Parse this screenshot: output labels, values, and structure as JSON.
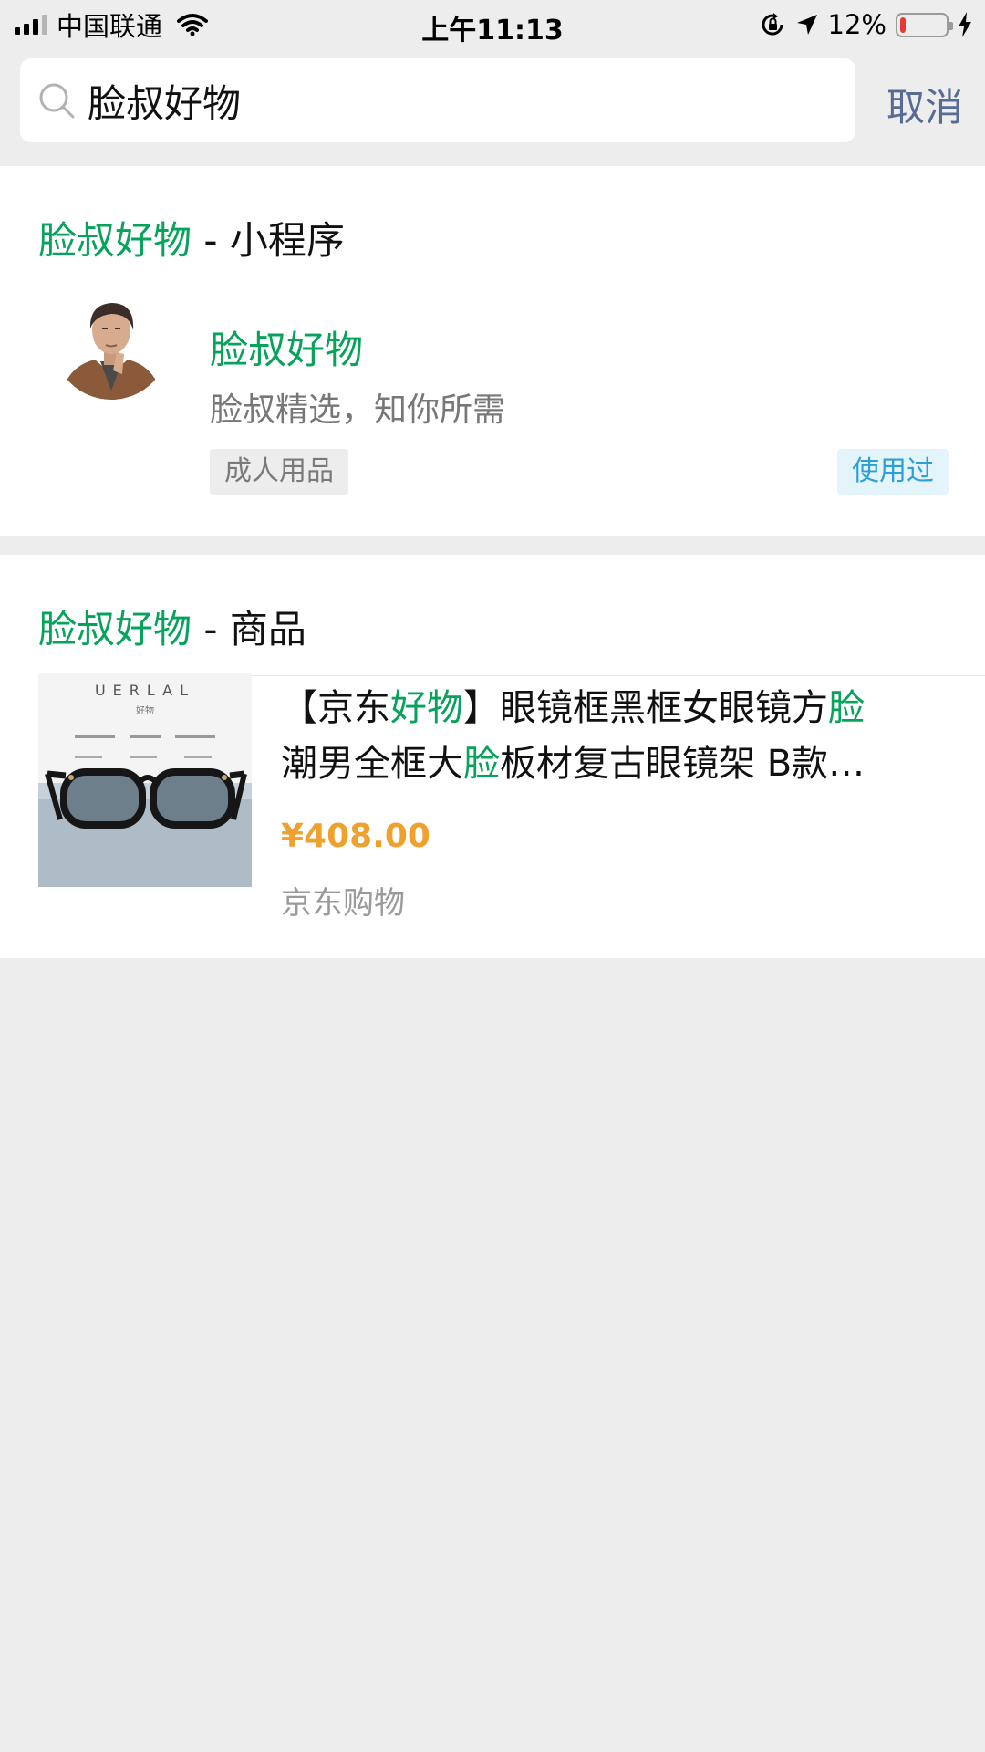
{
  "status_bar": {
    "carrier": "中国联通",
    "time": "上午11:13",
    "battery": "12%",
    "battery_level": 0.12,
    "icons": [
      "signal-icon",
      "wifi-icon",
      "orientation-lock-icon",
      "location-arrow-icon",
      "battery-icon",
      "charging-bolt-icon"
    ]
  },
  "search": {
    "value": "脸叔好物",
    "cancel_label": "取消"
  },
  "mini_program_section": {
    "header_highlight": "脸叔好物",
    "header_suffix": " - 小程序",
    "item": {
      "name": "脸叔好物",
      "description": "脸叔精选，知你所需",
      "category_tag": "成人用品",
      "used_tag": "使用过"
    }
  },
  "product_section": {
    "header_highlight": "脸叔好物",
    "header_suffix": " - 商品",
    "item": {
      "title_parts": [
        "【京东",
        "好物",
        "】眼镜框黑框女眼镜方",
        "脸",
        "潮男全框大",
        "脸",
        "板材复古眼镜架 B款…"
      ],
      "price": "¥408.00",
      "source": "京东购物",
      "image_brand_text": "UERLAL",
      "image_sub_text": "好物"
    }
  },
  "colors": {
    "highlight_green": "#07a35a",
    "cancel_blue": "#576b95",
    "price_orange": "#f0a02d",
    "used_tag_blue": "#2e9fd6",
    "background": "#ededed"
  }
}
